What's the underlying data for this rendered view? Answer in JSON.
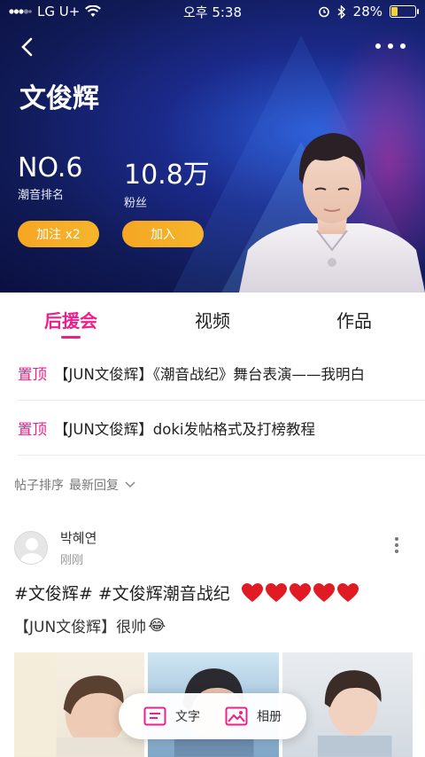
{
  "status_bar": {
    "carrier": "LG U+",
    "time": "오후 5:38",
    "battery_pct": "28%",
    "battery_level": 0.28
  },
  "header": {
    "star_name": "文俊辉",
    "rank": {
      "value": "NO.6",
      "label": "潮音排名"
    },
    "fans": {
      "value": "10.8万",
      "label": "粉丝"
    },
    "boost_button": "加注 x2",
    "join_button": "加入"
  },
  "tabs": [
    {
      "label": "后援会",
      "active": true
    },
    {
      "label": "视频",
      "active": false
    },
    {
      "label": "作品",
      "active": false
    }
  ],
  "pinned": [
    {
      "tag": "置顶",
      "title": "【JUN文俊辉】《潮音战纪》舞台表演——我明白"
    },
    {
      "tag": "置顶",
      "title": "【JUN文俊辉】doki发帖格式及打榜教程"
    }
  ],
  "sort": {
    "label": "帖子排序",
    "value": "最新回复"
  },
  "post": {
    "author": "박혜연",
    "time": "刚刚",
    "tags": "#文俊辉# #文俊辉潮音战纪",
    "heart_count": 5,
    "body": "【JUN文俊辉】很帅",
    "emoji": "😂"
  },
  "float_bar": {
    "text_label": "文字",
    "album_label": "相册"
  },
  "colors": {
    "accent": "#ee1f8a",
    "button": "#f6a623",
    "hero_bg": "#1b2a8a"
  }
}
